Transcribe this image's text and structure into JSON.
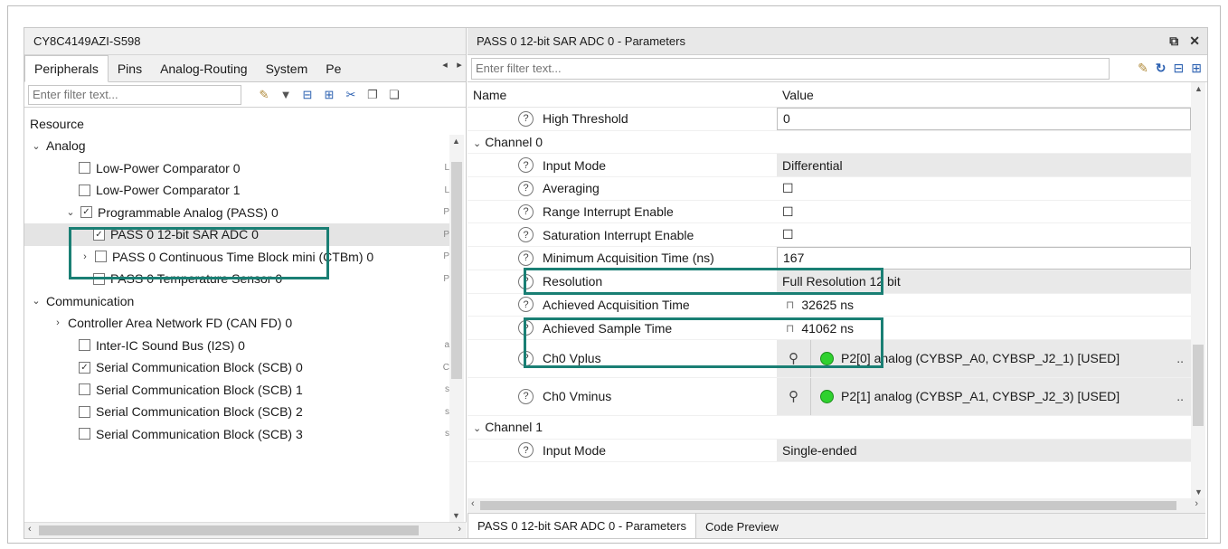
{
  "left_panel": {
    "title": "CY8C4149AZI-S598",
    "tabs": [
      "Peripherals",
      "Pins",
      "Analog-Routing",
      "System",
      "Pe"
    ],
    "filter_placeholder": "Enter filter text...",
    "column_header": "Resource",
    "tree": [
      {
        "label": "Analog",
        "chevron": "⌄",
        "checkbox": null
      },
      {
        "label": "Low-Power Comparator 0",
        "checkbox": "",
        "edge": "L"
      },
      {
        "label": "Low-Power Comparator 1",
        "checkbox": "",
        "edge": "L"
      },
      {
        "label": "Programmable Analog (PASS) 0",
        "chevron": "⌄",
        "checkbox": "✓",
        "edge": "P"
      },
      {
        "label": "PASS 0 12-bit SAR ADC 0",
        "checkbox": "✓",
        "edge": "P",
        "selected": true
      },
      {
        "label": "PASS 0 Continuous Time Block mini (CTBm) 0",
        "chevron": "›",
        "checkbox": "",
        "edge": "P"
      },
      {
        "label": "PASS 0 Temperature Sensor 0",
        "checkbox": "",
        "edge": "P"
      },
      {
        "label": "Communication",
        "chevron": "⌄",
        "checkbox": null
      },
      {
        "label": "Controller Area Network FD (CAN FD) 0",
        "chevron": "›",
        "checkbox": null
      },
      {
        "label": "Inter-IC Sound Bus (I2S) 0",
        "checkbox": "",
        "edge": "a"
      },
      {
        "label": "Serial Communication Block (SCB) 0",
        "checkbox": "✓",
        "edge": "C"
      },
      {
        "label": "Serial Communication Block (SCB) 1",
        "checkbox": "",
        "edge": "s"
      },
      {
        "label": "Serial Communication Block (SCB) 2",
        "checkbox": "",
        "edge": "s"
      },
      {
        "label": "Serial Communication Block (SCB) 3",
        "checkbox": "",
        "edge": "s"
      }
    ]
  },
  "right_panel": {
    "title": "PASS 0 12-bit SAR ADC 0 - Parameters",
    "filter_placeholder": "Enter filter text...",
    "header_name": "Name",
    "header_value": "Value",
    "rows": [
      {
        "type": "param",
        "name": "High Threshold",
        "value": "0",
        "style": "boxed"
      },
      {
        "type": "group",
        "name": "Channel 0"
      },
      {
        "type": "param",
        "name": "Input Mode",
        "value": "Differential",
        "style": "gray"
      },
      {
        "type": "param",
        "name": "Averaging",
        "value": "☐",
        "style": "plain"
      },
      {
        "type": "param",
        "name": "Range Interrupt Enable",
        "value": "☐",
        "style": "plain"
      },
      {
        "type": "param",
        "name": "Saturation Interrupt Enable",
        "value": "☐",
        "style": "plain"
      },
      {
        "type": "param",
        "name": "Minimum Acquisition Time (ns)",
        "value": "167",
        "style": "boxed"
      },
      {
        "type": "param",
        "name": "Resolution",
        "value": "Full Resolution 12 bit",
        "style": "gray"
      },
      {
        "type": "param",
        "name": "Achieved Acquisition Time",
        "value": "32625 ns",
        "style": "lock"
      },
      {
        "type": "param",
        "name": "Achieved Sample Time",
        "value": "41062 ns",
        "style": "lock"
      },
      {
        "type": "pin",
        "name": "Ch0 Vplus",
        "value": "P2[0] analog (CYBSP_A0, CYBSP_J2_1) [USED]"
      },
      {
        "type": "pin",
        "name": "Ch0 Vminus",
        "value": "P2[1] analog (CYBSP_A1, CYBSP_J2_3) [USED]"
      },
      {
        "type": "group",
        "name": "Channel 1"
      },
      {
        "type": "param",
        "name": "Input Mode",
        "value": "Single-ended",
        "style": "gray"
      }
    ],
    "bottom_tabs": [
      "PASS 0 12-bit SAR ADC 0 - Parameters",
      "Code Preview"
    ]
  },
  "colors": {
    "highlight": "#1a7f74",
    "pin_dot": "#2fd12f"
  }
}
